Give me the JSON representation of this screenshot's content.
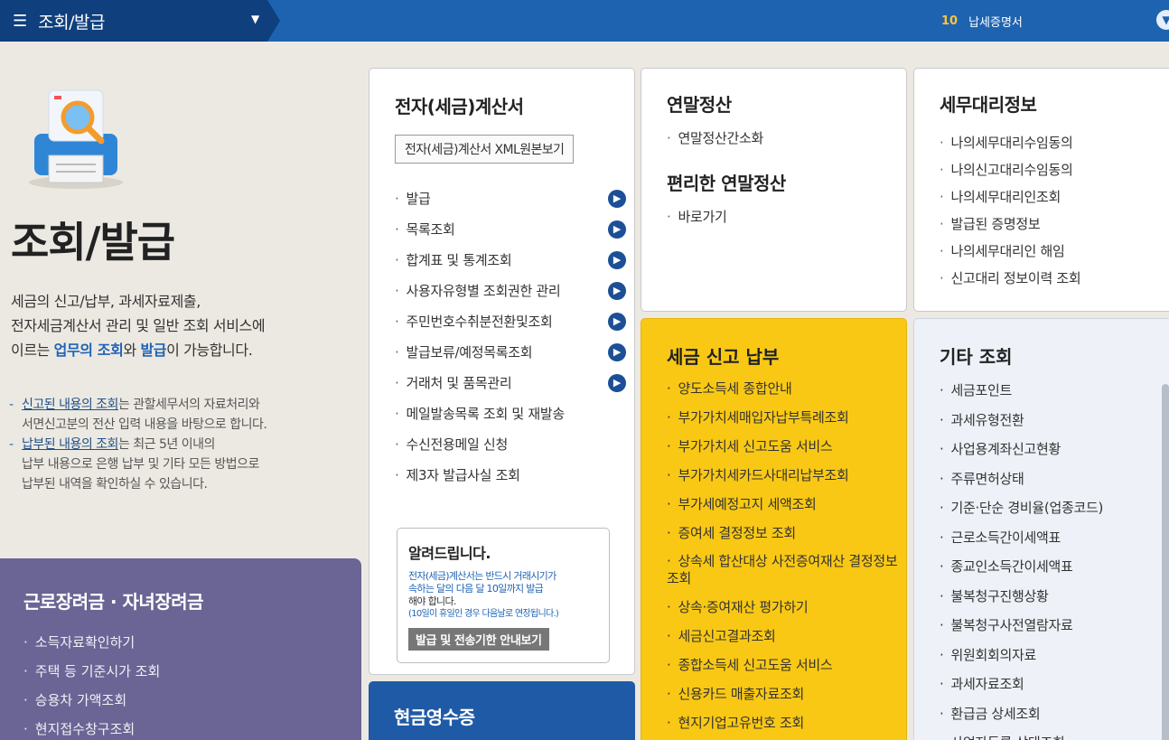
{
  "topbar": {
    "menu_icon": "hamburger-icon",
    "title": "조회/발급",
    "badge_num": "10",
    "badge_label": "납세증명서"
  },
  "hero": {
    "title": "조회/발급",
    "desc_line1": "세금의 신고/납부, 과세자료제출,",
    "desc_line2": "전자세금계산서 관리 및 일반 조회 서비스에",
    "desc_line3a": "이르는 ",
    "desc_line3_hl1": "업무의 조회",
    "desc_line3b": "와 ",
    "desc_line3_hl2": "발급",
    "desc_line3c": "이 가능합니다.",
    "note1_u": "신고된 내용의 조회",
    "note1_rest": "는 관할세무서의 자료처리와",
    "note1_line2": "서면신고분의 전산 입력 내용을 바탕으로 합니다.",
    "note2_u": "납부된 내용의 조회",
    "note2_rest": "는 최근 5년 이내의",
    "note2_line2": "납부 내용으로 은행 납부 및 기타 모든 방법으로",
    "note2_line3": "납부된 내역을 확인하실 수 있습니다."
  },
  "reward": {
    "title": "근로장려금 · 자녀장려금",
    "items": [
      "소득자료확인하기",
      "주택 등 기준시가 조회",
      "승용차 가액조회",
      "현지접수창구조회"
    ]
  },
  "esub": {
    "title": "전자(세금)계산서",
    "xml_button": "전자(세금)계산서 XML원본보기",
    "items": [
      "발급",
      "목록조회",
      "합계표 및 통계조회",
      "사용자유형별 조회권한 관리",
      "주민번호수취분전환및조회",
      "발급보류/예정목록조회",
      "거래처 및 품목관리",
      "메일발송목록 조회 및 재발송",
      "수신전용메일 신청",
      "제3자 발급사실 조회"
    ],
    "notice": {
      "title": "알려드립니다.",
      "line1": "전자(세금)계산서는 반드시 거래시기가",
      "line2": "속하는 달의 다음 달 10일까지 발급",
      "line3": "해야 합니다.",
      "line4": "(10일이 휴일인 경우 다음날로 연장됩니다.)",
      "button": "발급 및 전송기한 안내보기"
    }
  },
  "cash": {
    "title": "현금영수증"
  },
  "year": {
    "title": "연말정산",
    "item": "연말정산간소화",
    "sub_title": "편리한 연말정산",
    "sub_item": "바로가기"
  },
  "agent": {
    "title": "세무대리정보",
    "items": [
      "나의세무대리수임동의",
      "나의신고대리수임동의",
      "나의세무대리인조회",
      "발급된 증명정보",
      "나의세무대리인 해임",
      "신고대리 정보이력 조회"
    ]
  },
  "tax": {
    "title": "세금 신고 납부",
    "items": [
      "양도소득세 종합안내",
      "부가가치세매입자납부특례조회",
      "부가가치세 신고도움 서비스",
      "부가가치세카드사대리납부조회",
      "부가세예정고지 세액조회",
      "증여세 결정정보 조회",
      "상속세 합산대상 사전증여재산 결정정보 조회",
      "상속·증여재산 평가하기",
      "세금신고결과조회",
      "종합소득세 신고도움 서비스",
      "신용카드 매출자료조회",
      "현지기업고유번호 조회"
    ]
  },
  "etc": {
    "title": "기타 조회",
    "items": [
      "세금포인트",
      "과세유형전환",
      "사업용계좌신고현황",
      "주류면허상태",
      "기준·단순 경비율(업종코드)",
      "근로소득간이세액표",
      "종교인소득간이세액표",
      "불복청구진행상황",
      "불복청구사전열람자료",
      "위원회회의자료",
      "과세자료조회",
      "환급금 상세조회",
      "사업자등록 상태조회"
    ]
  },
  "colors": {
    "topbar": "#1e63b0",
    "crumb": "#0f3f7c",
    "tax_card": "#f9c814",
    "reward_box": "#6a6594",
    "cash_card": "#1f5aa6"
  }
}
